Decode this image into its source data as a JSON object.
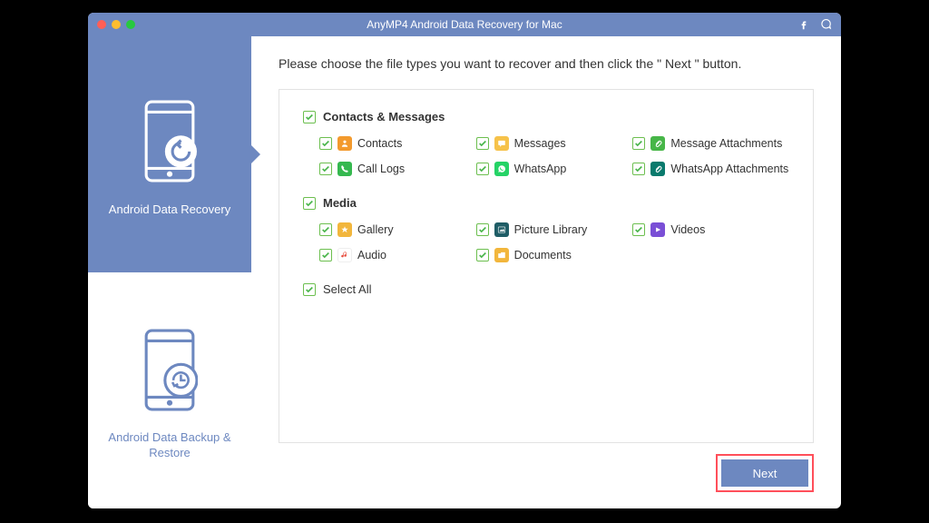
{
  "titlebar": {
    "title": "AnyMP4 Android Data Recovery for Mac"
  },
  "sidebar": {
    "recovery": {
      "label": "Android Data Recovery"
    },
    "backup": {
      "label": "Android Data Backup & Restore"
    }
  },
  "main": {
    "instruction": "Please choose the file types you want to recover and then click the \" Next \" button.",
    "group1": {
      "label": "Contacts & Messages"
    },
    "types": {
      "contacts": "Contacts",
      "messages": "Messages",
      "msg_att": "Message Attachments",
      "calllogs": "Call Logs",
      "whatsapp": "WhatsApp",
      "whatsapp_att": "WhatsApp Attachments"
    },
    "group2": {
      "label": "Media"
    },
    "media": {
      "gallery": "Gallery",
      "picture": "Picture Library",
      "videos": "Videos",
      "audio": "Audio",
      "documents": "Documents"
    },
    "select_all": "Select All",
    "next": "Next"
  }
}
